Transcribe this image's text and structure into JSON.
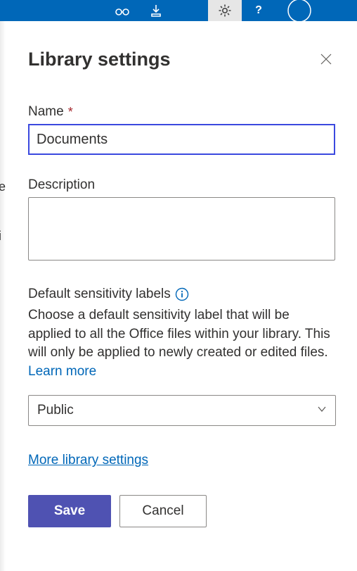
{
  "panel": {
    "title": "Library settings"
  },
  "fields": {
    "name": {
      "label": "Name",
      "value": "Documents"
    },
    "description": {
      "label": "Description",
      "value": ""
    },
    "sensitivity": {
      "label": "Default sensitivity labels",
      "help_text": "Choose a default sensitivity label that will be applied to all the Office files within your library. This will only be applied to newly created or edited files. ",
      "learn_more": "Learn more",
      "selected": "Public"
    }
  },
  "links": {
    "more_settings": "More library settings"
  },
  "buttons": {
    "save": "Save",
    "cancel": "Cancel"
  }
}
